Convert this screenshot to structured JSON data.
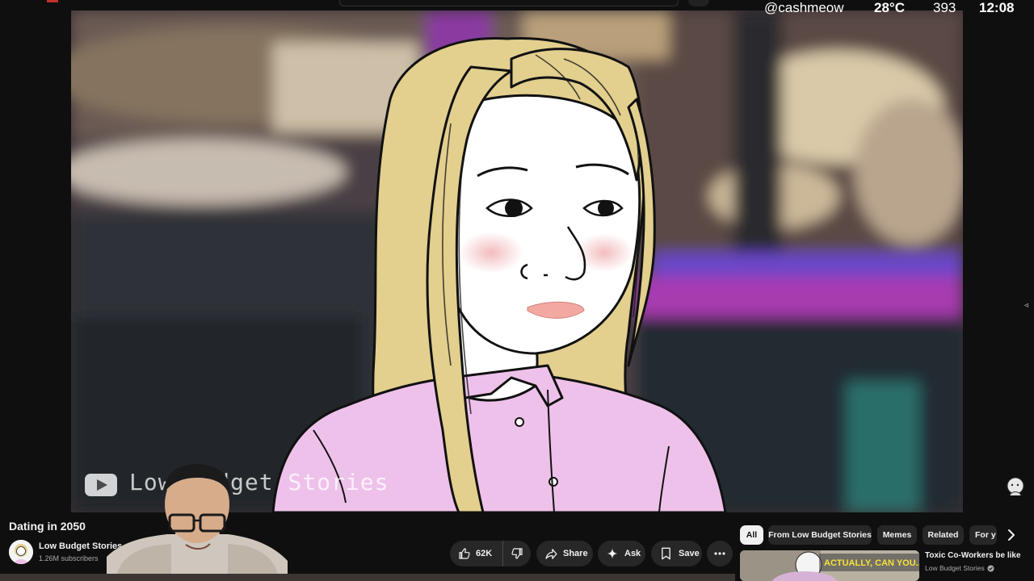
{
  "overlay": {
    "handle": "@cashmeow",
    "temperature": "28°C",
    "count": "393",
    "time": "12:08"
  },
  "video": {
    "watermark_text": "Low Budget Stories"
  },
  "title": "Dating in 2050",
  "channel": {
    "name": "Low Budget Stories",
    "subscribers": "1.26M subscribers"
  },
  "actions": {
    "like_count": "62K",
    "share_label": "Share",
    "ask_label": "Ask",
    "save_label": "Save"
  },
  "chips": {
    "all": "All",
    "from_channel": "From Low Budget Stories",
    "memes": "Memes",
    "related": "Related",
    "for_you": "For y"
  },
  "recommendation": {
    "thumb_caption": "ACTUALLY, CAN YOU...",
    "title": "Toxic Co-Workers be like",
    "channel": "Low Budget Stories"
  },
  "colors": {
    "background": "#0f0f0f",
    "pill": "#272727",
    "chip_active": "#f1f1f1",
    "shirt": "#eec1ea",
    "hair": "#e3cf8e"
  },
  "icons": [
    "like-icon",
    "dislike-icon",
    "share-icon",
    "ask-icon",
    "save-icon",
    "more-icon",
    "chevron-right-icon",
    "verified-icon",
    "youtube-logo-icon"
  ]
}
